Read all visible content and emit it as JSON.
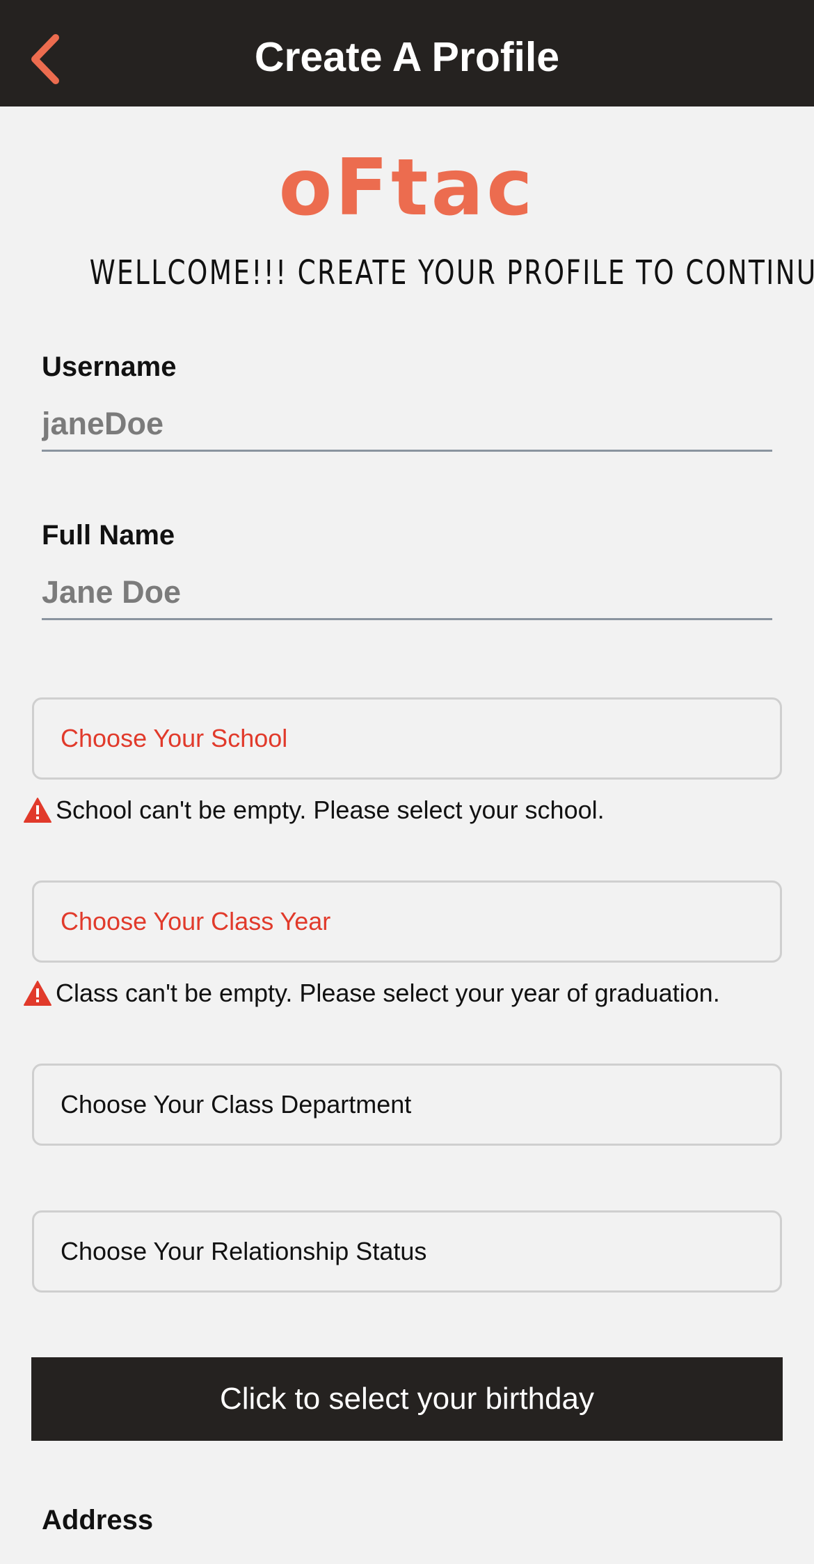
{
  "header": {
    "title": "Create A Profile",
    "back_icon": "chevron-left-icon",
    "accent_color": "#ec6c4f",
    "background": "#252220"
  },
  "logo": {
    "text": "oFtac"
  },
  "welcome": {
    "text": "WELLCOME!!! CREATE YOUR PROFILE TO CONTINUE"
  },
  "form": {
    "username": {
      "label": "Username",
      "placeholder": "janeDoe",
      "value": ""
    },
    "full_name": {
      "label": "Full Name",
      "placeholder": "Jane Doe",
      "value": ""
    },
    "school": {
      "label": "Choose Your School",
      "error": "School can't be empty. Please select your school."
    },
    "class_year": {
      "label": "Choose Your Class Year",
      "error": "Class can't be empty. Please select your year of graduation."
    },
    "class_department": {
      "label": "Choose Your Class Department"
    },
    "relationship_status": {
      "label": "Choose Your Relationship Status"
    },
    "birthday_button": {
      "label": "Click to select your birthday"
    },
    "address": {
      "label": "Address"
    }
  },
  "colors": {
    "error": "#e13a2b",
    "warning_icon": "#e13a2b"
  }
}
